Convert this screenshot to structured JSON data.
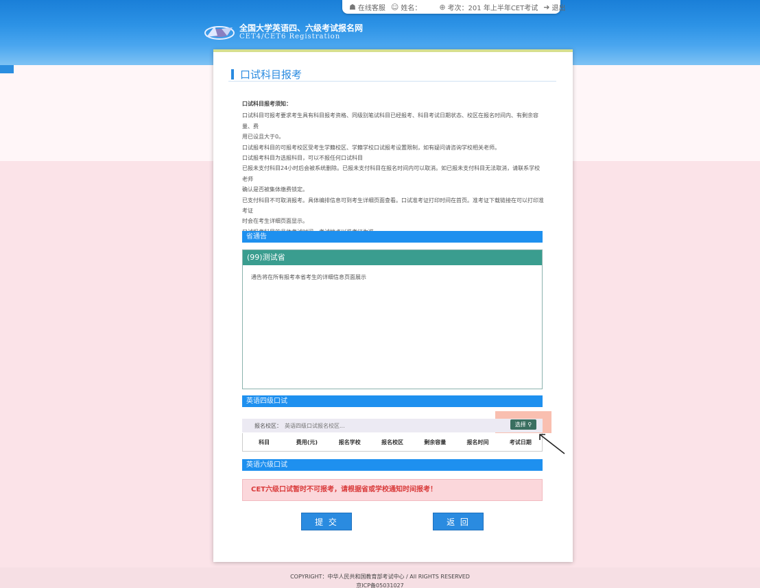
{
  "userbar": {
    "service": "在线客服",
    "name": "姓名：",
    "session": "考次：201 年上半年CET考试",
    "logout": "退出"
  },
  "logo": {
    "cn": "全国大学英语四、六级考试报名网",
    "en": "CET4/CET6  Registration"
  },
  "page_title": "口试科目报考",
  "notice": {
    "head": "口试科目报考须知：",
    "lines": [
      "口试科目可报考要求考生具有科目报考资格、同级别笔试科目已经报考、科目考试日期状态、校区在报名时间内、有剩余容量、费",
      "用已设且大于0。",
      "口试报考科目的可报考校区受考生学籍校区、学籍学校口试报考设置限制，如有疑问请咨询学校相关老师。",
      "口试报考科目为选报科目，可以不报任何口试科目",
      "已报未支付科目24小时后会被系统删除。已报未支付科目在报名时间内可以取消。如已报未支付科目无法取消，请联系学校老师",
      "确认是否被集体缴费锁定。",
      "已支付科目不可取消报考。具体编排信息可到考生详细页面查看。口试准考证打印时间在首页。准考证下载链接在可以打印准考证",
      "时会在考生详细页面显示。",
      "口试报考科目的具体考试时间、考试地点以准考证为准。"
    ]
  },
  "province_notice_label": "省通告",
  "province": {
    "name": "(99)测试省",
    "body": "通告将在所有报考本省考生的详细信息页面展示"
  },
  "cet4": {
    "section_label": "英语四级口试",
    "school_label": "报名校区：",
    "school_placeholder": "英语四级口试报名校区...",
    "select_label": "选择",
    "columns": [
      "科目",
      "费用(元)",
      "报名学校",
      "报名校区",
      "剩余容量",
      "报名时间",
      "考试日期"
    ]
  },
  "cet6": {
    "section_label": "英语六级口试",
    "warning": "CET六级口试暂时不可报考，请根据省或学校通知时间报考！"
  },
  "buttons": {
    "submit": "提 交",
    "back": "返 回"
  },
  "footer": {
    "copyright": "COPYRIGHT：中华人民共和国教育部考试中心 / All RIGHTS RESERVED",
    "icp": "京ICP备05031027"
  },
  "colors": {
    "header_blue": "#1a7fd8",
    "section_blue": "#1e90ef",
    "province_teal": "#3a9d8f",
    "warning_red": "#d93a3a"
  }
}
